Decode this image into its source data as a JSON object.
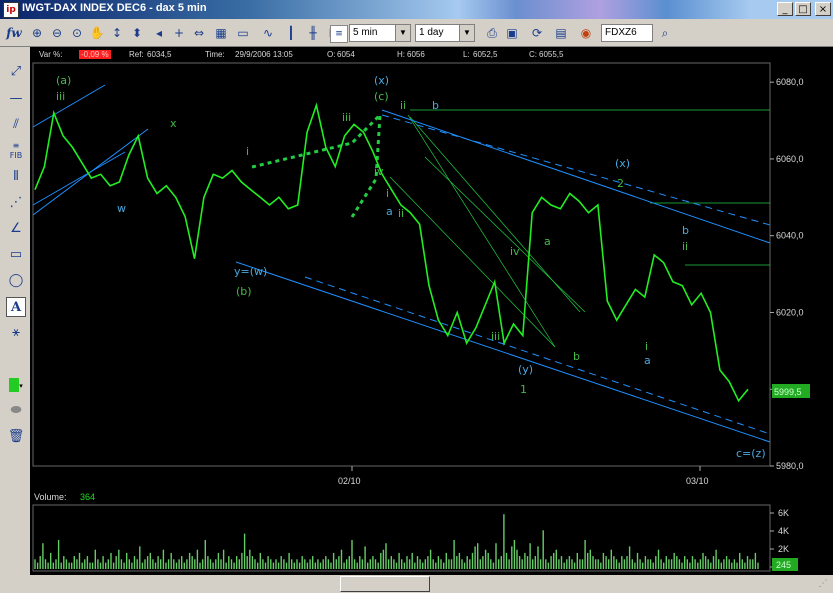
{
  "window": {
    "title": "IWGT-DAX INDEX DEC6 - dax 5 min",
    "app_icon": "ipro-icon",
    "minimize": "_",
    "maximize": "□",
    "close": "×"
  },
  "toolbar": {
    "label_fw": "fw",
    "interval_value": "5 min",
    "range_value": "1 day",
    "symbol_value": "FDXZ6"
  },
  "infobar": {
    "var_label": "Var %:",
    "var_value": "-0,09 %",
    "ref_label": "Ref:",
    "ref_value": "6034,5",
    "time_label": "Time:",
    "time_value": "29/9/2006 13:05",
    "o_label": "O:",
    "o_value": "6054",
    "h_label": "H:",
    "h_value": "6056",
    "l_label": "L:",
    "l_value": "6052,5",
    "c_label": "C:",
    "c_value": "6055,5"
  },
  "chart_data": {
    "type": "line",
    "yticks": [
      "6080,0",
      "6060,0",
      "6040,0",
      "6020,0",
      "6000,0",
      "5980,0"
    ],
    "ylim": [
      5980,
      6085
    ],
    "xticks": [
      "02/10",
      "03/10"
    ],
    "last_price": "5999,5",
    "series": [
      {
        "values": [
          6052,
          6058,
          6072,
          6066,
          6063,
          6059,
          6055,
          6056,
          6053,
          6054,
          6061,
          6066,
          6055,
          6051,
          6053,
          6050,
          6045,
          6034,
          6050,
          6056,
          6055,
          6057,
          6054,
          6052,
          6050,
          6048,
          6050,
          6047,
          6048,
          6067,
          6074,
          6063,
          6058,
          6066,
          6069,
          6067,
          6062,
          6056,
          6052,
          6048,
          6046,
          6043,
          6027,
          6018,
          6014,
          6020,
          6012,
          6016,
          6022,
          6028,
          6012,
          6017,
          6014,
          6046,
          6050,
          6048,
          6047,
          6051,
          6049,
          6046,
          6048,
          6023,
          6018,
          6022,
          6026,
          6024,
          6035,
          6033,
          6028,
          6027,
          6022,
          6025,
          6020,
          6005,
          6002,
          5997,
          6000
        ]
      }
    ],
    "annotations": [
      "(a)",
      "iii",
      "x",
      "w",
      "i",
      "y=(w)",
      "(b)",
      "iii",
      "(x)",
      "(c)",
      "ii",
      "b",
      "iv",
      "i",
      "a",
      "ii",
      "iv",
      "iii",
      "(y)",
      "1",
      "a",
      "b",
      "(x)",
      "2",
      "i",
      "a",
      "b",
      "ii",
      "c=(z)"
    ]
  },
  "volume": {
    "label": "Volume:",
    "value": "364",
    "last_value": "245",
    "yticks": [
      "6K",
      "4K",
      "2K",
      "0K"
    ],
    "values": [
      3,
      2,
      4,
      8,
      3,
      2,
      5,
      2,
      3,
      9,
      2,
      4,
      3,
      2,
      2,
      4,
      3,
      5,
      2,
      3,
      4,
      2,
      2,
      6,
      3,
      2,
      4,
      2,
      3,
      5,
      2,
      4,
      6,
      3,
      2,
      5,
      3,
      2,
      4,
      3,
      7,
      2,
      3,
      4,
      5,
      3,
      2,
      4,
      3,
      6,
      2,
      3,
      5,
      3,
      2,
      3,
      4,
      2,
      3,
      5,
      4,
      3,
      6,
      2,
      3,
      9,
      4,
      3,
      2,
      3,
      5,
      3,
      6,
      2,
      4,
      3,
      2,
      4,
      3,
      5,
      11,
      4,
      6,
      4,
      3,
      2,
      5,
      3,
      2,
      4,
      3,
      2,
      3,
      2,
      4,
      3,
      2,
      5,
      3,
      2,
      3,
      2,
      4,
      3,
      2,
      3,
      4,
      2,
      3,
      2,
      3,
      4,
      3,
      2,
      5,
      3,
      4,
      6,
      2,
      3,
      4,
      9,
      3,
      2,
      4,
      3,
      7,
      2,
      3,
      4,
      3,
      2,
      5,
      6,
      8,
      3,
      4,
      3,
      2,
      5,
      3,
      2,
      4,
      3,
      5,
      2,
      4,
      3,
      2,
      3,
      4,
      6,
      3,
      2,
      4,
      3,
      2,
      5,
      3,
      3,
      9,
      4,
      5,
      3,
      2,
      4,
      3,
      5,
      7,
      8,
      3,
      4,
      6,
      5,
      3,
      2,
      8,
      3,
      4,
      17,
      5,
      3,
      7,
      9,
      6,
      4,
      3,
      5,
      4,
      8,
      3,
      4,
      7,
      3,
      12,
      3,
      2,
      4,
      5,
      6,
      3,
      4,
      2,
      3,
      4,
      3,
      2,
      5,
      3,
      3,
      9,
      5,
      6,
      4,
      3,
      3,
      2,
      5,
      4,
      3,
      6,
      4,
      3,
      2,
      4,
      3,
      4,
      7,
      3,
      2,
      5,
      3,
      2,
      4,
      3,
      3,
      2,
      4,
      6,
      3,
      2,
      4,
      3,
      3,
      5,
      4,
      3,
      2,
      4,
      3,
      2,
      4,
      3,
      2,
      3,
      5,
      4,
      3,
      2,
      4,
      6,
      3,
      2,
      3,
      4,
      3,
      2,
      3,
      2,
      5,
      3,
      2,
      4,
      3,
      3,
      5,
      2
    ]
  }
}
